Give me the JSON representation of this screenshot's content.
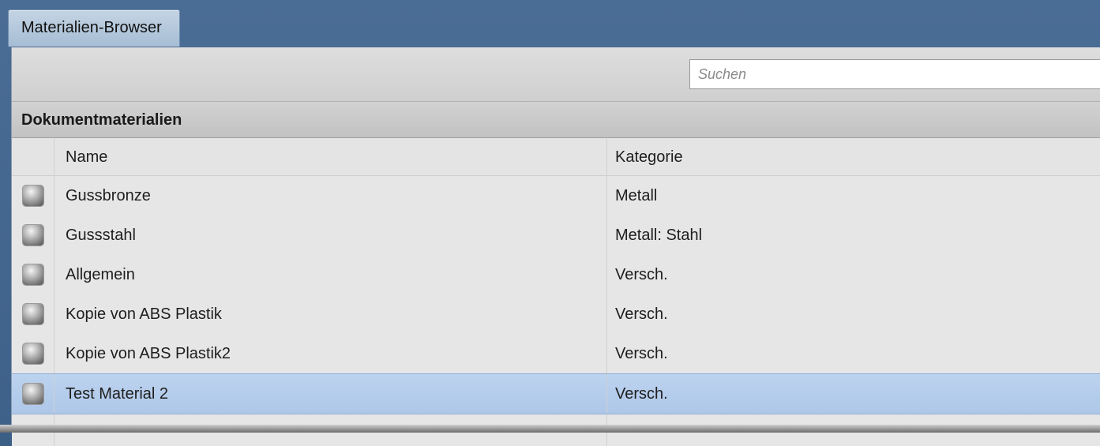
{
  "window": {
    "title": "Materialien-Browser"
  },
  "toolbar": {
    "search_placeholder": "Suchen"
  },
  "section": {
    "title": "Dokumentmaterialien"
  },
  "table": {
    "columns": {
      "name": "Name",
      "category": "Kategorie"
    },
    "rows": [
      {
        "name": "Gussbronze",
        "category": "Metall",
        "icon": "material-sphere-icon"
      },
      {
        "name": "Gussstahl",
        "category": "Metall: Stahl",
        "icon": "material-sphere-icon"
      },
      {
        "name": "Allgemein",
        "category": "Versch.",
        "icon": "material-sphere-icon"
      },
      {
        "name": "Kopie von ABS Plastik",
        "category": "Versch.",
        "icon": "material-sphere-icon"
      },
      {
        "name": "Kopie von ABS Plastik2",
        "category": "Versch.",
        "icon": "material-sphere-icon"
      },
      {
        "name": "Test Material 2",
        "category": "Versch.",
        "icon": "material-sphere-icon",
        "selected": true
      }
    ]
  },
  "colors": {
    "title_bar": "#3e6189",
    "selection": "#b4cceb",
    "panel": "#e6e6e6"
  }
}
